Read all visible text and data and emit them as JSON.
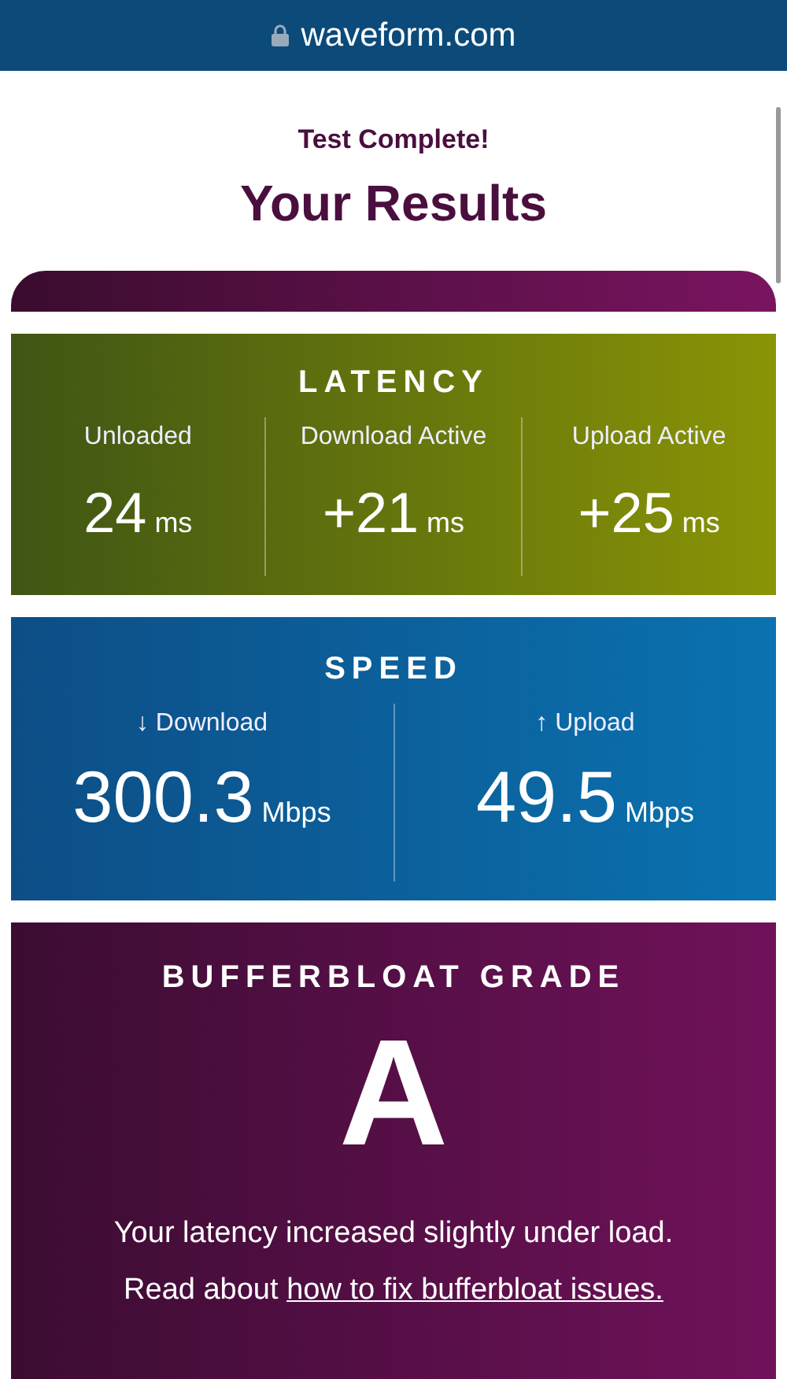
{
  "browser_bar": {
    "url": "waveform.com"
  },
  "header": {
    "subtitle": "Test Complete!",
    "title": "Your Results"
  },
  "latency": {
    "title": "LATENCY",
    "metrics": [
      {
        "label": "Unloaded",
        "value": "24",
        "unit": "ms"
      },
      {
        "label": "Download Active",
        "value": "+21",
        "unit": "ms"
      },
      {
        "label": "Upload Active",
        "value": "+25",
        "unit": "ms"
      }
    ]
  },
  "speed": {
    "title": "SPEED",
    "metrics": [
      {
        "label": "↓ Download",
        "value": "300.3",
        "unit": "Mbps"
      },
      {
        "label": "↑ Upload",
        "value": "49.5",
        "unit": "Mbps"
      }
    ]
  },
  "grade": {
    "title": "BUFFERBLOAT GRADE",
    "grade": "A",
    "message": "Your latency increased slightly under load.",
    "read_prefix": "Read about",
    "read_link": "how to fix bufferbloat issues."
  }
}
